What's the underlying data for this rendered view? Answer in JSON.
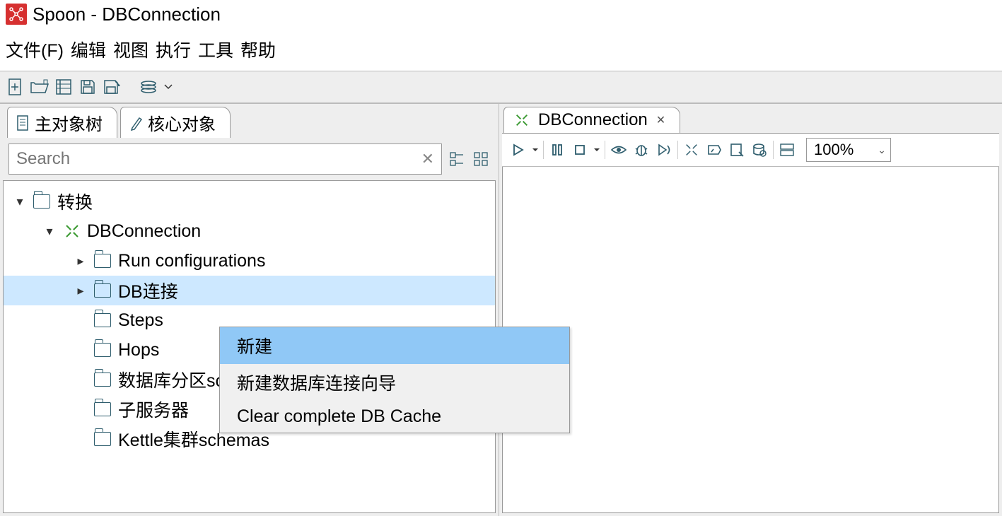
{
  "window": {
    "title": "Spoon - DBConnection"
  },
  "menu": {
    "file": "文件(F)",
    "edit": "编辑",
    "view": "视图",
    "run": "执行",
    "tools": "工具",
    "help": "帮助"
  },
  "leftPanel": {
    "tabs": {
      "main": "主对象树",
      "core": "核心对象"
    },
    "search": {
      "placeholder": "Search"
    },
    "tree": {
      "root": "转换",
      "transformation": "DBConnection",
      "items": {
        "runConfig": "Run configurations",
        "dbConn": "DB连接",
        "steps": "Steps",
        "hops": "Hops",
        "partition": "数据库分区schemas",
        "slave": "子服务器",
        "cluster": "Kettle集群schemas"
      }
    }
  },
  "contextMenu": {
    "new": "新建",
    "wizard": "新建数据库连接向导",
    "clear": "Clear complete DB Cache"
  },
  "rightPanel": {
    "tab": "DBConnection",
    "zoom": "100%"
  }
}
